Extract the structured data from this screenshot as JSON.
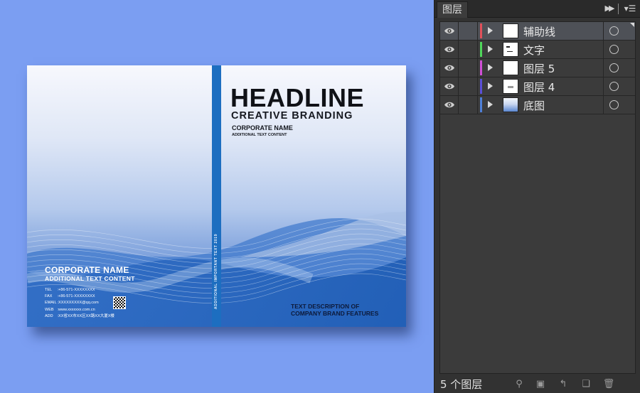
{
  "cover": {
    "headline": "HEADLINE",
    "subheadline": "CREATIVE BRANDING",
    "corporate_name": "CORPORATE NAME",
    "additional_text": "ADDITIONAL TEXT CONTENT",
    "spine_text": "ADDITIONAL IMPORTANT TEXT 2019",
    "back": {
      "corporate_name": "CORPORATE NAME",
      "additional_text": "ADDITIONAL TEXT CONTENT",
      "contacts": [
        {
          "label": "TEL",
          "value": ":+86-571-XXXXXXXX"
        },
        {
          "label": "FAX",
          "value": ":+86-571-XXXXXXXX"
        },
        {
          "label": "EMAIL",
          "value": ":XXXXXXXXX@qq.com"
        },
        {
          "label": "WEB",
          "value": ":www.xxxxxxx.com.cn"
        },
        {
          "label": "ADD",
          "value": ":XX省XX市XX区XX路XX大厦X楼"
        }
      ]
    },
    "description_line1": "TEXT DESCRIPTION OF",
    "description_line2": "COMPANY BRAND FEATURES"
  },
  "panel": {
    "tab_title": "图层",
    "collapse_icon": "double-chevron-right",
    "menu_icon": "panel-menu",
    "layers": [
      {
        "name": "辅助线",
        "color": "#e0505a",
        "selected": true
      },
      {
        "name": "文字",
        "color": "#4fd65a",
        "selected": false
      },
      {
        "name": "图层 5",
        "color": "#d04fd6",
        "selected": false
      },
      {
        "name": "图层 4",
        "color": "#5a4fd6",
        "selected": false
      },
      {
        "name": "底图",
        "color": "#4f7fd6",
        "selected": false
      }
    ],
    "footer_count": "5 个图层",
    "footer_icons": [
      "search-icon",
      "clipping-mask-icon",
      "sublayer-icon",
      "new-layer-icon",
      "trash-icon"
    ]
  }
}
